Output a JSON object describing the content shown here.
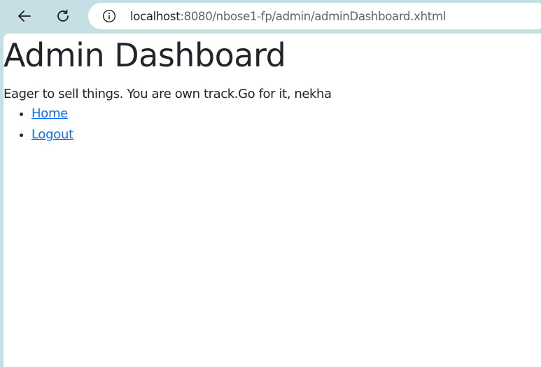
{
  "browser": {
    "back_icon": "arrow-left-icon",
    "reload_icon": "reload-icon",
    "info_icon": "info-icon",
    "url_host": "localhost",
    "url_rest": ":8080/nbose1-fp/admin/adminDashboard.xhtml"
  },
  "page": {
    "title": "Admin Dashboard",
    "greeting": "Eager to sell things. You are own track.Go for it, nekha",
    "links": [
      {
        "label": "Home"
      },
      {
        "label": "Logout"
      }
    ]
  },
  "colors": {
    "chrome_bg": "#c5dfe4",
    "link": "#0d6efd",
    "text": "#212529"
  }
}
